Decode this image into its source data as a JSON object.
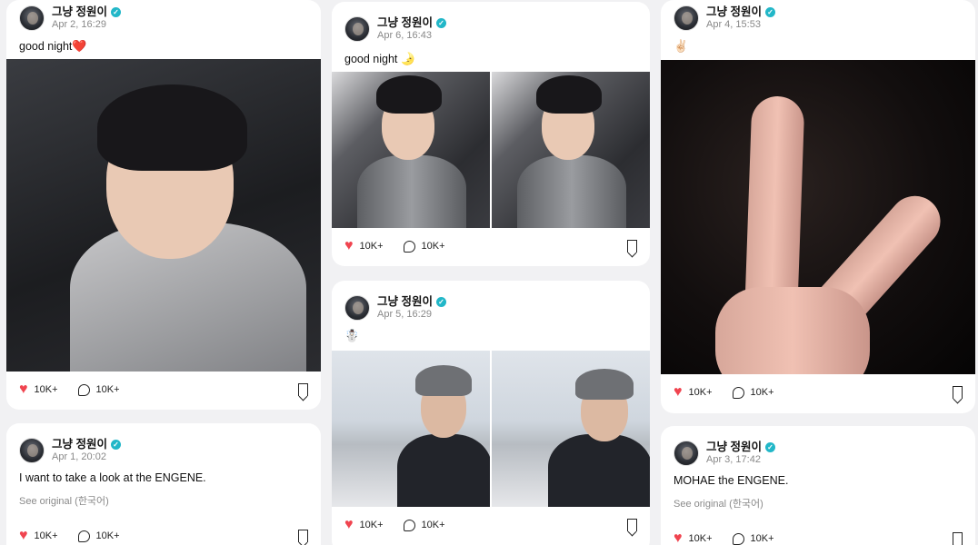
{
  "author": {
    "name": "그냥 정원이",
    "verified_mark": "✓"
  },
  "posts": [
    {
      "date": "Apr 2, 16:29",
      "text": "good night",
      "emoji": "❤️",
      "likes": "10K+",
      "comments": "10K+"
    },
    {
      "date": "Apr 1, 20:02",
      "text": "I want to take a look at the ENGENE.",
      "see_original": "See original (한국어)",
      "likes": "10K+",
      "comments": "10K+"
    },
    {
      "date": "Apr 6, 16:43",
      "text": "good night",
      "emoji": "🌛",
      "likes": "10K+",
      "comments": "10K+"
    },
    {
      "date": "Apr 5, 16:29",
      "emoji": "☃️",
      "likes": "10K+",
      "comments": "10K+"
    },
    {
      "date": "Apr 4, 15:53",
      "emoji": "✌🏻",
      "likes": "10K+",
      "comments": "10K+"
    },
    {
      "date": "Apr 3, 17:42",
      "text": "MOHAE the ENGENE.",
      "see_original": "See original (한국어)",
      "likes": "10K+",
      "comments": "10K+"
    }
  ],
  "icons": {
    "like": "heart-icon",
    "comment": "comment-bubble-icon",
    "save": "bookmark-icon",
    "verified": "verified-badge-icon"
  },
  "colors": {
    "like": "#f0444f",
    "verified": "#22b7c8",
    "background": "#f1f1f3"
  }
}
